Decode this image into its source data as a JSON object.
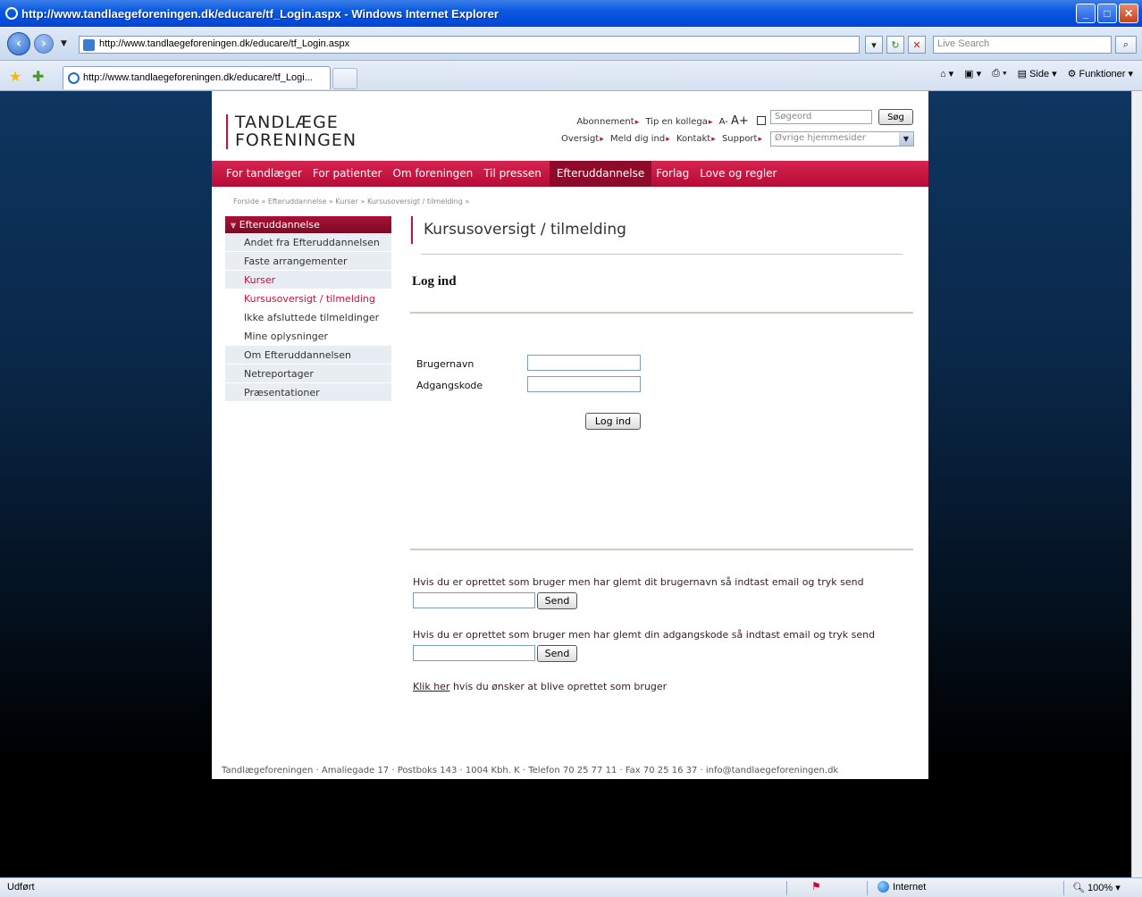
{
  "window": {
    "title": "http://www.tandlaegeforeningen.dk/educare/tf_Login.aspx - Windows Internet Explorer"
  },
  "browser": {
    "address": "http://www.tandlaegeforeningen.dk/educare/tf_Login.aspx",
    "search_placeholder": "Live Search",
    "tab_title": "http://www.tandlaegeforeningen.dk/educare/tf_Logi...",
    "cmd_page": "Side",
    "cmd_tools": "Funktioner",
    "status_text": "Udført",
    "zone": "Internet",
    "zoom": "100%"
  },
  "header": {
    "logo_line1": "TANDLÆGE",
    "logo_line2": "FORENINGEN",
    "links_row1": [
      "Abonnement",
      "Tip en kollega"
    ],
    "font_small": "A-",
    "font_big": "A+",
    "links_row2": [
      "Oversigt",
      "Meld dig ind",
      "Kontakt",
      "Support"
    ],
    "search_placeholder": "Søgeord",
    "search_button": "Søg",
    "sites_select": "Øvrige hjemmesider"
  },
  "nav": {
    "items": [
      "For tandlæger",
      "For patienter",
      "Om foreningen",
      "Til pressen",
      "Efteruddannelse",
      "Forlag",
      "Love og regler"
    ],
    "active": "Efteruddannelse"
  },
  "breadcrumb": "Forside » Efteruddannelse » Kurser » Kursusoversigt / tilmelding »",
  "sidebar": {
    "heading": "Efteruddannelse",
    "items": [
      "Andet fra Efteruddannelsen",
      "Faste arrangementer",
      "Kurser",
      "Kursusoversigt / tilmelding",
      "Ikke afsluttede tilmeldinger",
      "Mine oplysninger",
      "Om Efteruddannelsen",
      "Netreportager",
      "Præsentationer"
    ]
  },
  "content": {
    "title": "Kursusoversigt / tilmelding",
    "login_heading": "Log ind",
    "username_label": "Brugernavn",
    "password_label": "Adgangskode",
    "login_button": "Log ind",
    "forgot_username_text": "Hvis du er oprettet som bruger men har glemt dit brugernavn så indtast email og tryk send",
    "forgot_password_text": "Hvis du er oprettet som bruger men har glemt din adgangskode så indtast email og tryk send",
    "send_button": "Send",
    "register_link": "Klik her",
    "register_text": " hvis du ønsker at blive oprettet som bruger"
  },
  "footer": "Tandlægeforeningen · Amaliegade 17 · Postboks 143 · 1004 Kbh. K · Telefon 70 25 77 11 · Fax 70 25 16 37 · info@tandlaegeforeningen.dk",
  "colors": {
    "brand_red": "#c4103b",
    "nav_active": "#8e0a2b"
  }
}
